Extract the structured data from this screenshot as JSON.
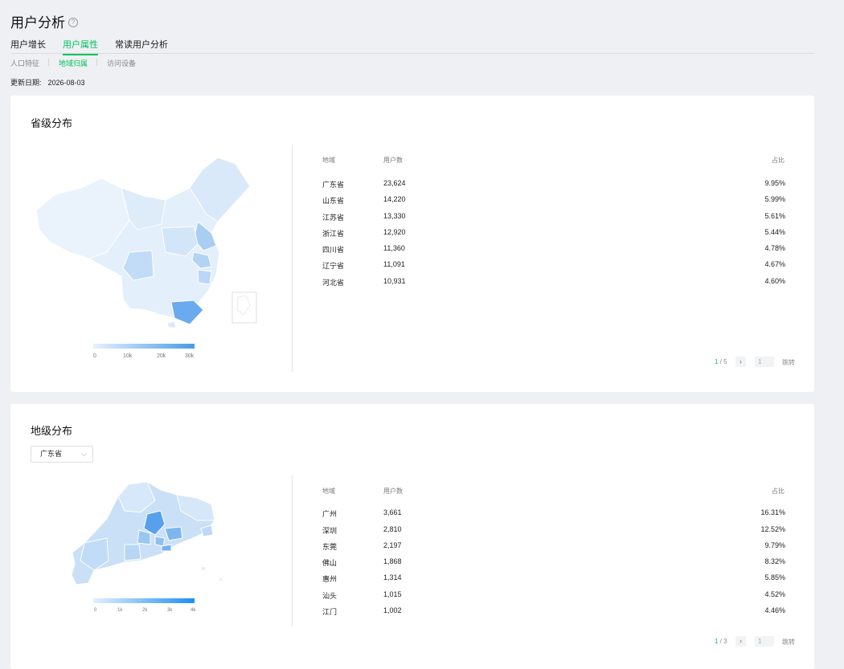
{
  "header": {
    "title": "用户分析",
    "help_icon": "?"
  },
  "tabs": [
    {
      "label": "用户增长",
      "active": false
    },
    {
      "label": "用户属性",
      "active": true
    },
    {
      "label": "常读用户分析",
      "active": false
    }
  ],
  "subtabs": [
    {
      "label": "人口特征",
      "active": false
    },
    {
      "label": "地域归属",
      "active": true
    },
    {
      "label": "访问设备",
      "active": false
    }
  ],
  "update": {
    "label": "更新日期:",
    "value": "2026-08-03"
  },
  "province_section": {
    "title": "省级分布",
    "columns": [
      "地域",
      "用户数",
      "占比"
    ],
    "rows": [
      {
        "region": "广东省",
        "users": "23,624",
        "share": "9.95%"
      },
      {
        "region": "山东省",
        "users": "14,220",
        "share": "5.99%"
      },
      {
        "region": "江苏省",
        "users": "13,330",
        "share": "5.61%"
      },
      {
        "region": "浙江省",
        "users": "12,920",
        "share": "5.44%"
      },
      {
        "region": "四川省",
        "users": "11,360",
        "share": "4.78%"
      },
      {
        "region": "辽宁省",
        "users": "11,091",
        "share": "4.67%"
      },
      {
        "region": "河北省",
        "users": "10,931",
        "share": "4.60%"
      }
    ],
    "legend": [
      "0",
      "10k",
      "20k",
      "30k"
    ],
    "pager": {
      "current": "1",
      "total": "5",
      "input_placeholder": "1",
      "jump": "跳转",
      "next": "›"
    }
  },
  "city_section": {
    "title": "地级分布",
    "select_value": "广东省",
    "columns": [
      "地域",
      "用户数",
      "占比"
    ],
    "rows": [
      {
        "region": "广州",
        "users": "3,661",
        "share": "16.31%"
      },
      {
        "region": "深圳",
        "users": "2,810",
        "share": "12.52%"
      },
      {
        "region": "东莞",
        "users": "2,197",
        "share": "9.79%"
      },
      {
        "region": "佛山",
        "users": "1,868",
        "share": "8.32%"
      },
      {
        "region": "惠州",
        "users": "1,314",
        "share": "5.85%"
      },
      {
        "region": "汕头",
        "users": "1,015",
        "share": "4.52%"
      },
      {
        "region": "江门",
        "users": "1,002",
        "share": "4.46%"
      }
    ],
    "legend": [
      "0",
      "1k",
      "2k",
      "3k",
      "4k"
    ],
    "pager": {
      "current": "1",
      "total": "3",
      "input_placeholder": "1",
      "jump": "跳转",
      "next": "›"
    }
  },
  "colors": {
    "accent": "#07c160",
    "map_light": "#e3effb",
    "map_dark": "#2f8de8"
  }
}
